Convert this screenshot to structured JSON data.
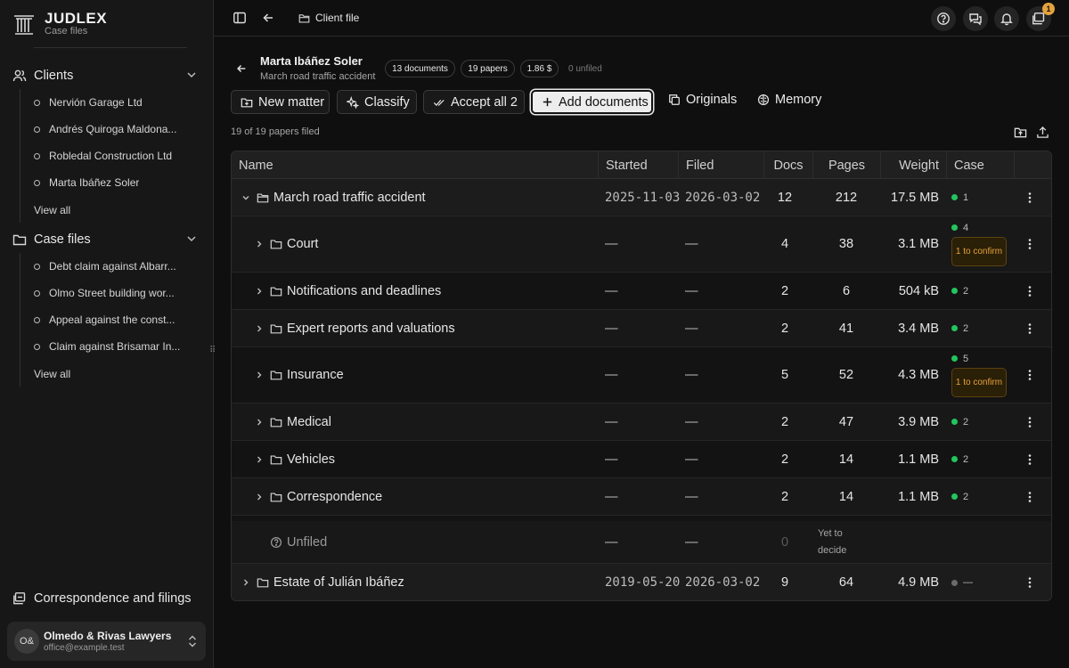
{
  "brand": {
    "name": "JUDLEX",
    "subtitle": "Case files"
  },
  "sidebar": {
    "clients": {
      "title": "Clients",
      "items": [
        "Nervión Garage Ltd",
        "Andrés Quiroga Maldona...",
        "Robledal Construction Ltd",
        "Marta Ibáñez Soler"
      ],
      "view_all": "View all"
    },
    "case_files": {
      "title": "Case files",
      "items": [
        "Debt claim against Albarr...",
        "Olmo Street building wor...",
        "Appeal against the const...",
        "Claim against Brisamar In..."
      ],
      "view_all": "View all"
    },
    "bottom_link": "Correspondence and filings",
    "account": {
      "initials": "O&",
      "name": "Olmedo & Rivas Lawyers",
      "email": "office@example.test"
    }
  },
  "topbar": {
    "breadcrumb": "Client file",
    "notification_count": "1"
  },
  "header": {
    "client_name": "Marta Ibáñez Soler",
    "matter": "March road traffic accident",
    "pills": {
      "documents": "13 documents",
      "papers": "19 papers",
      "cost": "1.86 $",
      "unfiled": "0 unfiled"
    }
  },
  "actions": {
    "new_matter": "New matter",
    "classify": "Classify",
    "accept_all": "Accept all 2",
    "add_documents": "Add documents",
    "originals": "Originals",
    "memory": "Memory"
  },
  "filed_summary": "19 of 19 papers filed",
  "table": {
    "headers": {
      "name": "Name",
      "started": "Started",
      "filed": "Filed",
      "docs": "Docs",
      "pages": "Pages",
      "weight": "Weight",
      "case": "Case"
    },
    "matter_row": {
      "name": "March road traffic accident",
      "started": "2025-11-03",
      "filed": "2026-03-02",
      "docs": "12",
      "pages": "212",
      "weight": "17.5 MB",
      "case": "1"
    },
    "folders": [
      {
        "name": "Court",
        "started": "—",
        "filed": "—",
        "docs": "4",
        "pages": "38",
        "weight": "3.1 MB",
        "case": "4",
        "confirm": "1 to confirm"
      },
      {
        "name": "Notifications and deadlines",
        "started": "—",
        "filed": "—",
        "docs": "2",
        "pages": "6",
        "weight": "504 kB",
        "case": "2"
      },
      {
        "name": "Expert reports and valuations",
        "started": "—",
        "filed": "—",
        "docs": "2",
        "pages": "41",
        "weight": "3.4 MB",
        "case": "2"
      },
      {
        "name": "Insurance",
        "started": "—",
        "filed": "—",
        "docs": "5",
        "pages": "52",
        "weight": "4.3 MB",
        "case": "5",
        "confirm": "1 to confirm"
      },
      {
        "name": "Medical",
        "started": "—",
        "filed": "—",
        "docs": "2",
        "pages": "47",
        "weight": "3.9 MB",
        "case": "2"
      },
      {
        "name": "Vehicles",
        "started": "—",
        "filed": "—",
        "docs": "2",
        "pages": "14",
        "weight": "1.1 MB",
        "case": "2"
      },
      {
        "name": "Correspondence",
        "started": "—",
        "filed": "—",
        "docs": "2",
        "pages": "14",
        "weight": "1.1 MB",
        "case": "2"
      }
    ],
    "unfiled_row": {
      "name": "Unfiled",
      "started": "—",
      "filed": "—",
      "docs": "0",
      "pages": "Yet to decide"
    },
    "estate_row": {
      "name": "Estate of Julián Ibáñez",
      "started": "2019-05-20",
      "filed": "2026-03-02",
      "docs": "9",
      "pages": "64",
      "weight": "4.9 MB",
      "case": "—"
    }
  },
  "colors": {
    "accent": "#22c55e",
    "warning": "#e6a23c",
    "background": "#0f0f0f",
    "sidebar": "#171717"
  }
}
